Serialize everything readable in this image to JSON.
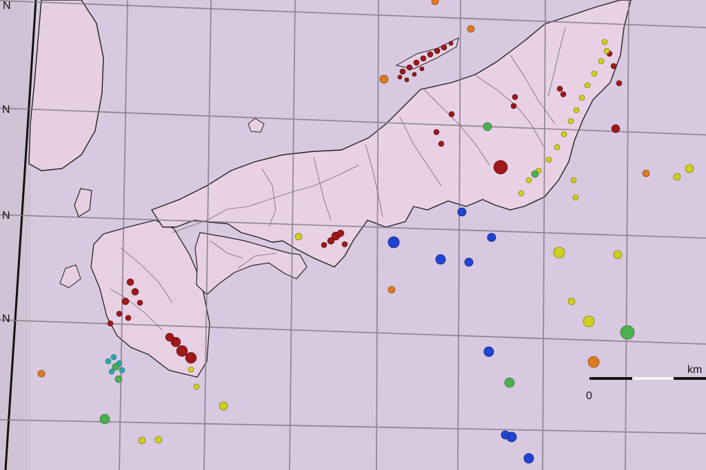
{
  "map": {
    "colors": {
      "ocean": "#d7c9e3",
      "land": "#e8cfe4",
      "coast": "#2a2a2a",
      "grid": "#7e7a86",
      "deep": "#1f43d6",
      "intermediate": "#4caf50",
      "mid": "#c9d119",
      "shallow": "#a01818",
      "orange": "#e07a22"
    },
    "lat_labels": [
      "N",
      "N",
      "N",
      "N"
    ],
    "scale": {
      "start_label": "0",
      "unit_label": "km"
    }
  }
}
